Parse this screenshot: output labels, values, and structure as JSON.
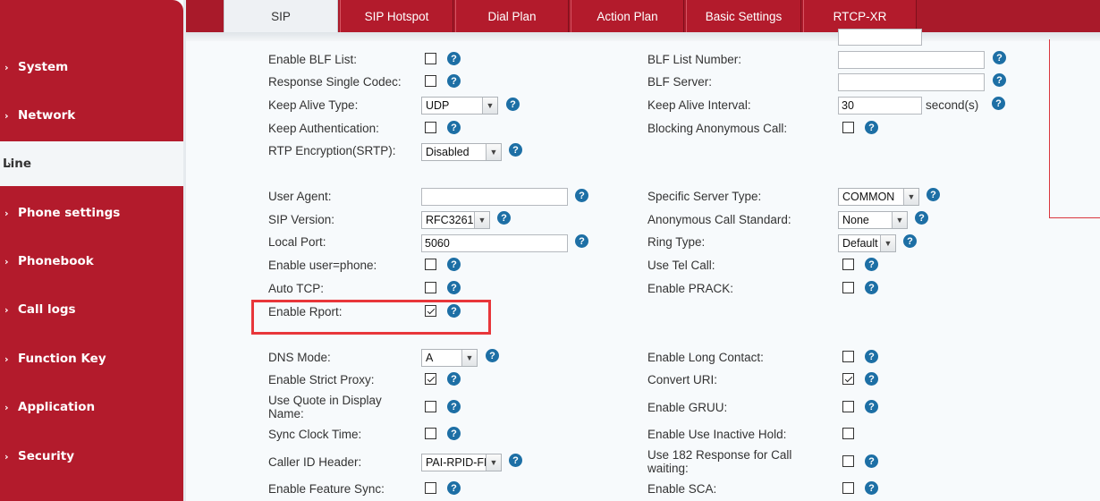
{
  "sidebar": {
    "items": [
      {
        "label": "System"
      },
      {
        "label": "Network"
      },
      {
        "label": "Line"
      },
      {
        "label": "Phone settings"
      },
      {
        "label": "Phonebook"
      },
      {
        "label": "Call logs"
      },
      {
        "label": "Function Key"
      },
      {
        "label": "Application"
      },
      {
        "label": "Security"
      }
    ],
    "chevron": "›"
  },
  "tabs": [
    {
      "label": "SIP"
    },
    {
      "label": "SIP Hotspot"
    },
    {
      "label": "Dial Plan"
    },
    {
      "label": "Action Plan"
    },
    {
      "label": "Basic Settings"
    },
    {
      "label": "RTCP-XR"
    }
  ],
  "form": {
    "left": {
      "enable_blf_list": {
        "label": "Enable BLF List:"
      },
      "response_single_codec": {
        "label": "Response Single Codec:"
      },
      "keep_alive_type": {
        "label": "Keep Alive Type:",
        "value": "UDP"
      },
      "keep_authentication": {
        "label": "Keep Authentication:"
      },
      "rtp_encryption": {
        "label": "RTP Encryption(SRTP):",
        "value": "Disabled"
      },
      "user_agent": {
        "label": "User Agent:",
        "value": ""
      },
      "sip_version": {
        "label": "SIP Version:",
        "value": "RFC3261"
      },
      "local_port": {
        "label": "Local Port:",
        "value": "5060"
      },
      "enable_user_phone": {
        "label": "Enable user=phone:"
      },
      "auto_tcp": {
        "label": "Auto TCP:"
      },
      "enable_rport": {
        "label": "Enable Rport:",
        "checked": true
      },
      "dns_mode": {
        "label": "DNS Mode:",
        "value": "A"
      },
      "enable_strict_proxy": {
        "label": "Enable Strict Proxy:",
        "checked": true
      },
      "use_quote": {
        "label_1": "Use Quote in Display",
        "label_2": "Name:"
      },
      "sync_clock_time": {
        "label": "Sync Clock Time:"
      },
      "caller_id_header": {
        "label": "Caller ID Header:",
        "value": "PAI-RPID-FF"
      },
      "enable_feature_sync": {
        "label": "Enable Feature Sync:"
      }
    },
    "right": {
      "blf_list_number": {
        "label": "BLF List Number:",
        "value": ""
      },
      "blf_server": {
        "label": "BLF Server:",
        "value": ""
      },
      "keep_alive_interval": {
        "label": "Keep Alive Interval:",
        "value": "30",
        "unit": "second(s)"
      },
      "blocking_anonymous_call": {
        "label": "Blocking Anonymous Call:"
      },
      "specific_server_type": {
        "label": "Specific Server Type:",
        "value": "COMMON"
      },
      "anonymous_call_standard": {
        "label": "Anonymous Call Standard:",
        "value": "None"
      },
      "ring_type": {
        "label": "Ring Type:",
        "value": "Default"
      },
      "use_tel_call": {
        "label": "Use Tel Call:"
      },
      "enable_prack": {
        "label": "Enable PRACK:"
      },
      "enable_long_contact": {
        "label": "Enable Long Contact:"
      },
      "convert_uri": {
        "label": "Convert URI:",
        "checked": true
      },
      "enable_gruu": {
        "label": "Enable GRUU:"
      },
      "enable_use_inactive_hold": {
        "label": "Enable Use Inactive Hold:"
      },
      "use_182_response": {
        "label_1": "Use 182 Response for Call",
        "label_2": "waiting:"
      },
      "enable_sca": {
        "label": "Enable SCA:"
      }
    }
  },
  "help_glyph": "?",
  "dropdown_glyph": "▼",
  "colors": {
    "brand_red": "#b31b2c",
    "help_blue": "#1d6fa5",
    "highlight": "#e8363a"
  }
}
